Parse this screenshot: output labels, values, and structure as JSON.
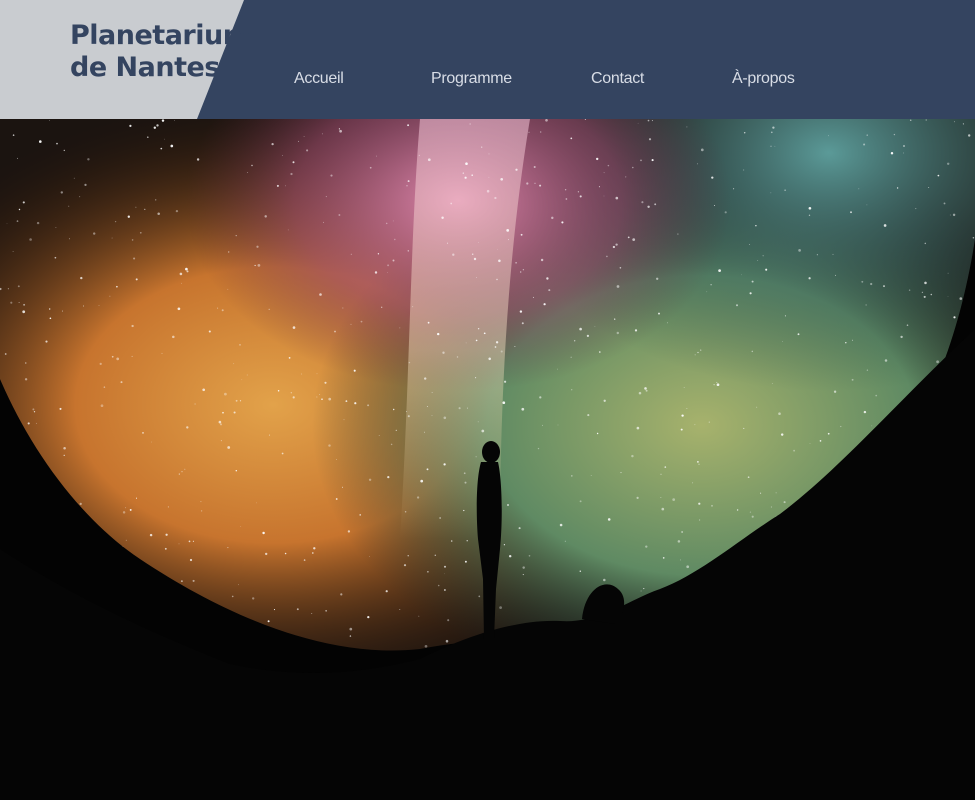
{
  "site": {
    "logo_line1": "Planetarium",
    "logo_line2": "de Nantes"
  },
  "nav": {
    "items": [
      {
        "label": "Accueil"
      },
      {
        "label": "Programme"
      },
      {
        "label": "Contact"
      },
      {
        "label": "À-propos"
      }
    ]
  },
  "colors": {
    "header_bg": "#344460",
    "logo_panel_bg": "#c9ccd0",
    "logo_text": "#344460",
    "nav_text": "#d8dde6"
  }
}
